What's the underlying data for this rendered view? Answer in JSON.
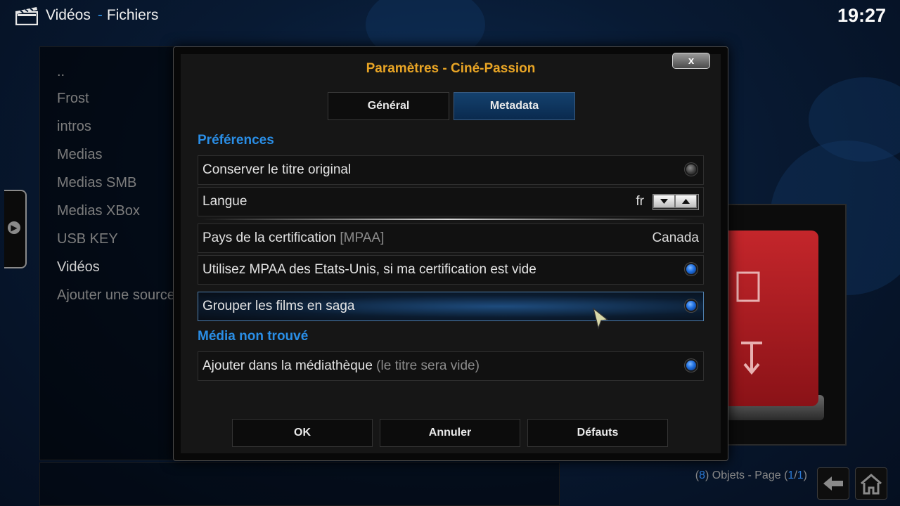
{
  "header": {
    "section": "Vidéos",
    "subsection": "Fichiers",
    "clock": "19:27",
    "icon": "clapperboard-icon"
  },
  "file_list": {
    "items": [
      {
        "label": ".."
      },
      {
        "label": "Frost"
      },
      {
        "label": "intros"
      },
      {
        "label": "Medias"
      },
      {
        "label": "Medias SMB"
      },
      {
        "label": "Medias XBox"
      },
      {
        "label": "USB KEY"
      },
      {
        "label": "Vidéos"
      },
      {
        "label": "Ajouter une source"
      }
    ],
    "active_item": "Vidéos"
  },
  "status_bar": {
    "count": "8",
    "objects_text": "Objets - Page",
    "page": "1",
    "pages": "1",
    "back_icon": "back-arrow-icon",
    "home_icon": "home-icon"
  },
  "dialog": {
    "title": "Paramètres - Ciné-Passion",
    "close_label": "x",
    "tabs": [
      {
        "label": "Général",
        "active": false
      },
      {
        "label": "Metadata",
        "active": true
      }
    ],
    "sections": {
      "preferences": "Préférences",
      "media_not_found": "Média non trouvé"
    },
    "settings": {
      "keep_title": {
        "label": "Conserver le titre original",
        "enabled": false
      },
      "language": {
        "label": "Langue",
        "value": "fr"
      },
      "cert_country": {
        "label": "Pays de la certification",
        "label_suffix": "[MPAA]",
        "value": "Canada"
      },
      "use_mpaa": {
        "label": "Utilisez MPAA des Etats-Unis, si ma certification est vide",
        "enabled": true
      },
      "group_saga": {
        "label": "Grouper les films en saga",
        "enabled": true,
        "focused": true
      },
      "add_library": {
        "label": "Ajouter dans la médiathèque",
        "label_suffix": "(le titre sera vide)",
        "enabled": true
      }
    },
    "buttons": {
      "ok": "OK",
      "cancel": "Annuler",
      "defaults": "Défauts"
    }
  },
  "colors": {
    "accent_blue": "#2a8ee6",
    "title_orange": "#e9a525",
    "background": "#081a33"
  }
}
